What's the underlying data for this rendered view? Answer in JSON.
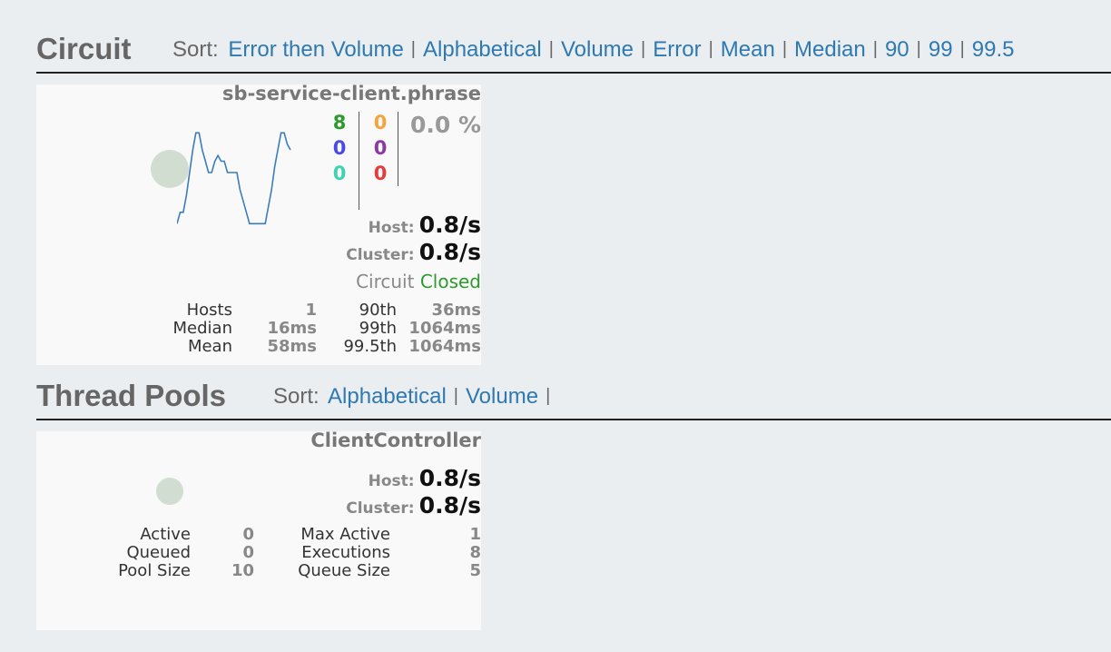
{
  "circuit_section": {
    "title": "Circuit",
    "sort_label": "Sort:",
    "sort_options": [
      "Error then Volume",
      "Alphabetical",
      "Volume",
      "Error",
      "Mean",
      "Median",
      "90",
      "99",
      "99.5"
    ]
  },
  "circuit_card": {
    "name": "sb-service-client.phrase",
    "counts": {
      "success": "8",
      "short_circuited": "0",
      "bad_request": "0",
      "timeout": "0",
      "rejected": "0",
      "failure": "0"
    },
    "error_percentage": "0.0 %",
    "host_label": "Host:",
    "host_rate": "0.8/s",
    "cluster_label": "Cluster:",
    "cluster_rate": "0.8/s",
    "circuit_label": "Circuit",
    "circuit_state": "Closed",
    "stats": {
      "hosts_label": "Hosts",
      "hosts": "1",
      "median_label": "Median",
      "median": "16ms",
      "mean_label": "Mean",
      "mean": "58ms",
      "p90_label": "90th",
      "p90": "36ms",
      "p99_label": "99th",
      "p99": "1064ms",
      "p995_label": "99.5th",
      "p995": "1064ms"
    },
    "colors": {
      "success": "#2d9a2d",
      "short_circuited": "#4a4ae6",
      "bad_request": "#3ed2b0",
      "timeout": "#f5a33c",
      "rejected": "#8a3aa3",
      "failure": "#e83a3a",
      "sparkline": "#3a7dbf"
    },
    "sparkline": [
      3,
      5,
      5,
      8,
      12,
      16,
      19,
      19,
      16,
      14,
      12,
      12,
      14,
      15,
      14,
      14,
      12,
      12,
      12,
      12,
      9,
      7,
      5,
      3,
      3,
      3,
      3,
      3,
      3,
      6,
      9,
      13,
      16,
      19,
      19,
      17,
      16
    ]
  },
  "threadpool_section": {
    "title": "Thread Pools",
    "sort_label": "Sort:",
    "sort_options": [
      "Alphabetical",
      "Volume"
    ]
  },
  "threadpool_card": {
    "name": "ClientController",
    "host_label": "Host:",
    "host_rate": "0.8/s",
    "cluster_label": "Cluster:",
    "cluster_rate": "0.8/s",
    "stats": {
      "active_label": "Active",
      "active": "0",
      "queued_label": "Queued",
      "queued": "0",
      "pool_size_label": "Pool Size",
      "pool_size": "10",
      "max_active_label": "Max Active",
      "max_active": "1",
      "executions_label": "Executions",
      "executions": "8",
      "queue_size_label": "Queue Size",
      "queue_size": "5"
    }
  }
}
